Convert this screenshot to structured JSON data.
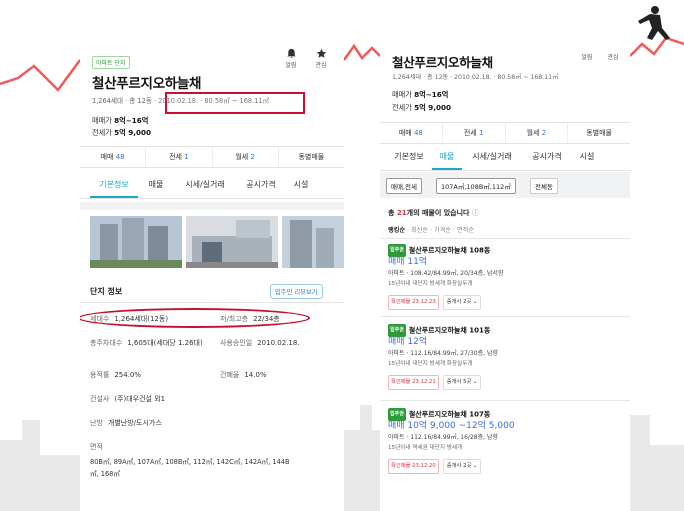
{
  "colors": {
    "accent_teal": "#1aa9c6",
    "link_blue": "#3a6fd8",
    "green": "#2e9a3a",
    "highlight_red": "#c8102e",
    "bg_zigzag": "#f05a5a"
  },
  "left": {
    "tag": "아파트 단지",
    "title": "철산푸르지오하늘채",
    "subtitle_a": "1,264세대 · 총 12동 · ",
    "subtitle_b": "2010.02.18. · 80.58㎡ ~ 168.11㎡",
    "bell_label": "알림",
    "star_label": "관심",
    "sale_label": "매매가",
    "sale_value": "8억~16억",
    "jeonse_label": "전세가",
    "jeonse_value": "5억 9,000",
    "box_tabs": [
      {
        "label": "매매",
        "count": "48"
      },
      {
        "label": "전세",
        "count": "1"
      },
      {
        "label": "월세",
        "count": "2"
      },
      {
        "label": "동별매물",
        "count": ""
      }
    ],
    "main_tabs": [
      "기본정보",
      "매물",
      "시세/실거래",
      "공시가격",
      "시설"
    ],
    "section_title": "단지 정보",
    "review_btn": "입주민 리뷰보기",
    "rows": [
      {
        "l1": "세대수",
        "v1": "1,264세대(12동)",
        "l2": "저/최고층",
        "v2": "22/34층"
      },
      {
        "l1": "총주차대수",
        "v1": "1,605대(세대당 1.26대)",
        "l2": "사용승인일",
        "v2": "2010.02.18."
      },
      {
        "l1": "용적률",
        "v1": "254.0%",
        "l2": "건폐율",
        "v2": "14.0%"
      }
    ],
    "builder_label": "건설사",
    "builder_value": "(주)대우건설 외1",
    "heating_label": "난방",
    "heating_value": "개별난방/도시가스",
    "area_label": "면적",
    "area_value_1": "80B㎡, 89A㎡, 107A㎡, 108B㎡, 112㎡, 142C㎡, 142A㎡, 144B",
    "area_value_2": "㎡, 168㎡"
  },
  "right": {
    "title": "철산푸르지오하늘채",
    "subtitle": "1,264세대 · 총 12동 · 2010.02.18. · 80.58㎡ ~ 168.11㎡",
    "bell_label": "알림",
    "star_label": "관심",
    "sale_label": "매매가",
    "sale_value": "8억~16억",
    "jeonse_label": "전세가",
    "jeonse_value": "5억 9,000",
    "box_tabs": [
      {
        "label": "매매",
        "count": "48"
      },
      {
        "label": "전세",
        "count": "1"
      },
      {
        "label": "월세",
        "count": "2"
      },
      {
        "label": "동별매물",
        "count": ""
      }
    ],
    "main_tabs": [
      "기본정보",
      "매물",
      "시세/실거래",
      "공시가격",
      "시설"
    ],
    "chips": [
      "매매,전세",
      "107A㎡,108B㎡,112㎡",
      "전체동"
    ],
    "total_prefix": "총 ",
    "total_count": "21",
    "total_suffix": "개의 매물이 있습니다",
    "sorts": [
      "랭킹순",
      "최신순",
      "가격순",
      "면적순"
    ],
    "listings": [
      {
        "badge": "입주권",
        "name": "철산푸르지오하늘채 108동",
        "price": "매매 11억",
        "detail": "아파트 · 108.42/84.99㎡, 20/34층, 남서향",
        "tags": "15년이내  대단지  방세개  화장실두개",
        "confirm": "확인매물 23.12.23",
        "agent": "중개사 2곳 ⌄"
      },
      {
        "badge": "입주권",
        "name": "철산푸르지오하늘채 101동",
        "price": "매매 12억",
        "detail": "아파트 · 112.16/84.99㎡, 27/30층, 남향",
        "tags": "15년이내  대단지  방세개  화장실두개",
        "confirm": "확인매물 23.12.21",
        "agent": "중개사 5곳 ⌄"
      },
      {
        "badge": "입주권",
        "name": "철산푸르지오하늘채 107동",
        "price": "매매 10억 9,000 ~12억 5,000",
        "detail": "아파트 · 112.16/84.99㎡, 16/28층, 남향",
        "tags": "15년이내  역세권  대단지  방세개",
        "confirm": "확인매물 23.12.20",
        "agent": "중개사 2곳 ⌄"
      }
    ]
  }
}
